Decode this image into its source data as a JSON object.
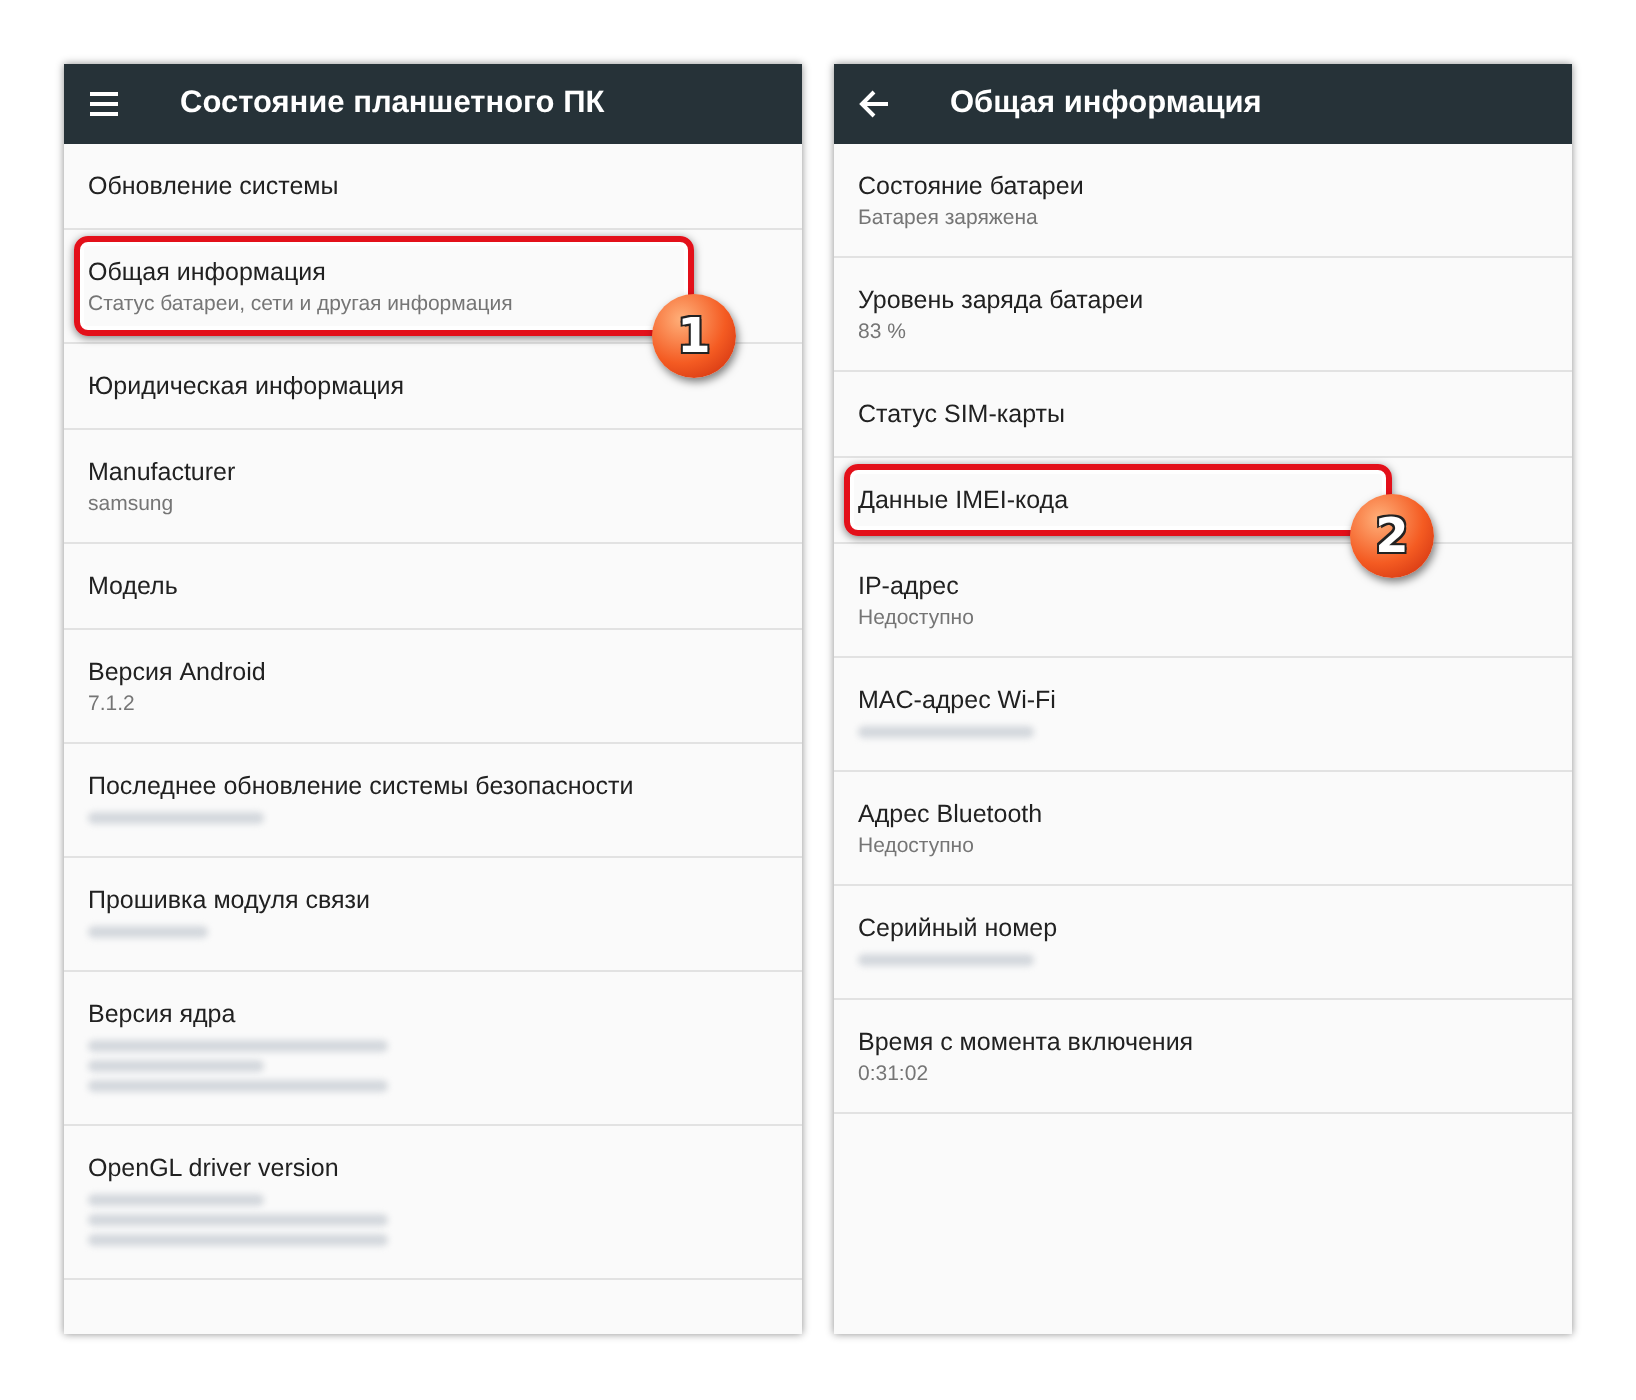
{
  "panels": [
    {
      "app_bar": {
        "nav": {
          "kind": "menu"
        },
        "title": "Состояние планшетного ПК"
      },
      "items": [
        {
          "title": "Обновление системы",
          "highlighted": false
        },
        {
          "title": "Общая информация",
          "summary": "Статус батареи, сети и другая информация",
          "highlighted": true,
          "callout": "1"
        },
        {
          "title": "Юридическая информация",
          "highlighted": false
        },
        {
          "title": "Manufacturer",
          "summary": "samsung",
          "highlighted": false
        },
        {
          "title": "Модель",
          "highlighted": false
        },
        {
          "title": "Версия Android",
          "summary": "7.1.2",
          "highlighted": false
        },
        {
          "title": "Последнее обновление системы безопасности",
          "blurred_summary": [
            {
              "kind": "medium"
            }
          ],
          "highlighted": false
        },
        {
          "title": "Прошивка модуля связи",
          "blurred_summary": [
            {
              "kind": "short"
            }
          ],
          "highlighted": false
        },
        {
          "title": "Версия ядра",
          "blurred_summary": [
            {
              "kind": "long"
            },
            {
              "kind": "medium"
            },
            {
              "kind": "long"
            }
          ],
          "highlighted": false
        },
        {
          "title": "OpenGL driver version",
          "blurred_summary": [
            {
              "kind": "medium"
            },
            {
              "kind": "long"
            },
            {
              "kind": "long"
            }
          ],
          "highlighted": false
        }
      ]
    },
    {
      "app_bar": {
        "nav": {
          "kind": "back"
        },
        "title": "Общая информация"
      },
      "items": [
        {
          "title": "Состояние батареи",
          "summary": "Батарея заряжена",
          "highlighted": false
        },
        {
          "title": "Уровень заряда батареи",
          "summary": "83 %",
          "highlighted": false
        },
        {
          "title": "Статус SIM-карты",
          "highlighted": false
        },
        {
          "title": "Данные IMEI-кода",
          "highlighted": true,
          "callout": "2"
        },
        {
          "title": "IP-адрес",
          "summary": "Недоступно",
          "highlighted": false
        },
        {
          "title": "MAC-адрес Wi-Fi",
          "blurred_summary": [
            {
              "kind": "medium"
            }
          ],
          "highlighted": false
        },
        {
          "title": "Адрес Bluetooth",
          "summary": "Недоступно",
          "highlighted": false
        },
        {
          "title": "Серийный номер",
          "blurred_summary": [
            {
              "kind": "medium"
            }
          ],
          "highlighted": false
        },
        {
          "title": "Время с момента включения",
          "summary": "0:31:02",
          "highlighted": false
        }
      ]
    }
  ]
}
